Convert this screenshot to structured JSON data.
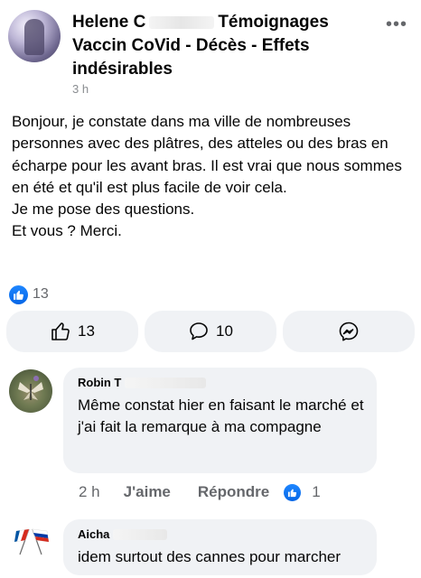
{
  "post": {
    "author_first": "Helene C",
    "group_name": "Témoignages Vaccin CoVid - Décès - Effets indésirables",
    "time": "3 h",
    "body": "Bonjour,  je constate dans ma ville de nombreuses personnes avec des plâtres,  des atteles  ou des bras en écharpe pour les avant  bras. Il est vrai que  nous sommes  en été et qu'il est plus facile de voir cela.\nJe me pose des questions.\nEt vous ? Merci.",
    "reaction_count": "13"
  },
  "actions": {
    "like_count": "13",
    "comment_count": "10"
  },
  "comments": [
    {
      "author": "Robin T",
      "text": "Même  constat hier en faisant le marché et j'ai fait la remarque à ma compagne",
      "time": "2 h",
      "like_label": "J'aime",
      "reply_label": "Répondre",
      "reaction_count": "1"
    },
    {
      "author": "Aicha",
      "text": "idem surtout des cannes pour marcher"
    }
  ],
  "icons": {
    "more": "more-dots-icon",
    "like": "thumbs-up-icon",
    "comment": "comment-bubble-icon",
    "share": "messenger-icon"
  },
  "colors": {
    "like_blue": "#0866ff",
    "bubble_bg": "#f0f2f5",
    "meta_gray": "#65676b"
  }
}
